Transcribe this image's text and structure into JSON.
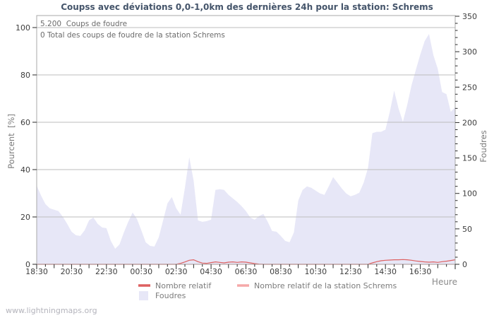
{
  "header": {
    "title": "Coupss avec déviations 0,0-1,0km des dernières 24h pour la station: Schrems"
  },
  "annotations": {
    "total_strikes": "5.200  Coups de foudre",
    "station_total": "0 Total des coups de foudre de la station Schrems"
  },
  "watermark": "www.lightningmaps.org",
  "colors": {
    "background": "#ffffff",
    "title_text": "#44546a",
    "frame": "#a8a8a8",
    "gridline": "#bdbdbd",
    "tick": "#2a2a2a",
    "area_fill": "#e7e7f7",
    "line_relative": "#dd6060",
    "line_station": "#f5a8a8"
  },
  "chart_data": {
    "type": "area",
    "title": "Coupss avec déviations 0,0-1,0km des dernières 24h pour la station: Schrems",
    "x_axis": {
      "label": "Heure",
      "start": "18:30",
      "span_hours": 24,
      "sample_interval_minutes": 15,
      "tick_labels": [
        "18:30",
        "20:30",
        "22:30",
        "00:30",
        "02:30",
        "04:30",
        "06:30",
        "08:30",
        "10:30",
        "12:30",
        "14:30",
        "16:30"
      ],
      "minor_tick_minutes": 30
    },
    "y_left": {
      "label": "Pourcent  [%]",
      "ticks": [
        0,
        20,
        40,
        60,
        80,
        100
      ],
      "range": [
        0,
        100
      ]
    },
    "y_right": {
      "label": "Foudres",
      "ticks": [
        0,
        50,
        100,
        150,
        200,
        250,
        300,
        350
      ],
      "minor_step": 10,
      "range": [
        0,
        350
      ]
    },
    "grid": "horizontal-major",
    "legend_position": "bottom",
    "series": [
      {
        "name": "Nombre relatif",
        "type": "line",
        "axis": "left",
        "color": "#dd6060",
        "values": [
          0,
          0,
          0,
          0,
          0,
          0,
          0,
          0,
          0,
          0,
          0,
          0,
          0,
          0,
          0,
          0,
          0,
          0,
          0,
          0,
          0,
          0,
          0,
          0,
          0,
          0,
          0,
          0,
          0,
          0,
          0,
          0,
          0,
          0.4,
          1.0,
          1.7,
          1.9,
          1.1,
          0.5,
          0.4,
          0.7,
          1.0,
          0.8,
          0.6,
          0.9,
          1.0,
          0.8,
          1.0,
          0.9,
          0.6,
          0.3,
          0.1,
          0,
          0,
          0,
          0,
          0,
          0,
          0,
          0,
          0,
          0,
          0,
          0,
          0,
          0,
          0,
          0,
          0,
          0,
          0,
          0,
          0,
          0,
          0,
          0,
          0,
          0.6,
          1.1,
          1.5,
          1.7,
          1.8,
          1.9,
          1.9,
          2.0,
          1.9,
          1.7,
          1.4,
          1.2,
          1.0,
          0.9,
          1.0,
          0.8,
          1.1,
          1.3,
          1.6,
          1.9
        ]
      },
      {
        "name": "Nombre relatif de la station Schrems",
        "type": "line",
        "axis": "left",
        "color": "#f5a8a8",
        "constant_value": 0,
        "points": 97
      },
      {
        "name": "Foudres",
        "type": "area",
        "axis": "right",
        "color": "#e7e7f7",
        "values": [
          111,
          97,
          85,
          79,
          77,
          75,
          67,
          57,
          46,
          41,
          40,
          48,
          62,
          66,
          57,
          52,
          51,
          33,
          22,
          28,
          45,
          60,
          73,
          64,
          48,
          31,
          26,
          25,
          38,
          62,
          86,
          95,
          79,
          70,
          108,
          151,
          118,
          62,
          60,
          61,
          63,
          105,
          106,
          105,
          98,
          93,
          88,
          82,
          75,
          66,
          63,
          68,
          71,
          60,
          47,
          46,
          40,
          33,
          31,
          45,
          90,
          105,
          110,
          108,
          104,
          100,
          98,
          110,
          123,
          115,
          107,
          100,
          96,
          98,
          101,
          115,
          136,
          185,
          187,
          187,
          190,
          215,
          245,
          220,
          201,
          225,
          253,
          275,
          296,
          315,
          325,
          295,
          276,
          243,
          240,
          215,
          222
        ]
      }
    ]
  }
}
